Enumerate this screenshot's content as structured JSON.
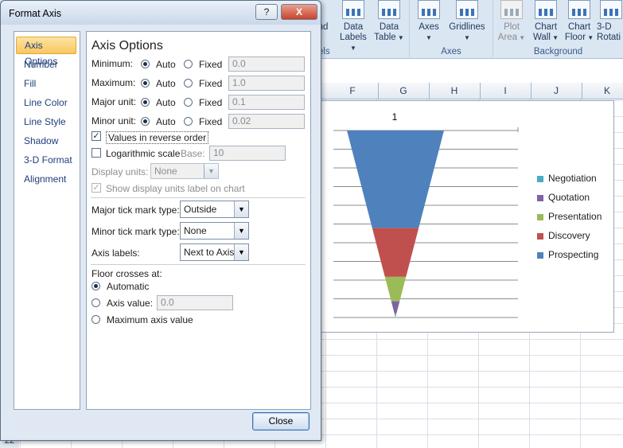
{
  "ribbon": {
    "buttons": [
      {
        "label": "nd",
        "disabled": false
      },
      {
        "label": "Data",
        "label2": "Labels",
        "dropdown": true,
        "disabled": false
      },
      {
        "label": "Data",
        "label2": "Table",
        "dropdown": true,
        "disabled": false
      },
      {
        "label": "Axes",
        "dropdown": true,
        "disabled": false
      },
      {
        "label": "Gridlines",
        "dropdown": true,
        "disabled": false
      },
      {
        "label": "Plot",
        "label2": "Area",
        "dropdown": true,
        "disabled": true
      },
      {
        "label": "Chart",
        "label2": "Wall",
        "dropdown": true,
        "disabled": false
      },
      {
        "label": "Chart",
        "label2": "Floor",
        "dropdown": true,
        "disabled": false
      },
      {
        "label": "3-D",
        "label2": "Rotati",
        "disabled": false
      }
    ],
    "groups": {
      "labels_fragment": "els",
      "axes": "Axes",
      "background": "Background"
    }
  },
  "sheet": {
    "columns": [
      "F",
      "G",
      "H",
      "I",
      "J",
      "K"
    ],
    "row_fragment": "22"
  },
  "chart_data": {
    "type": "bar",
    "title": "1",
    "series": [
      {
        "name": "Negotiation",
        "values": [
          0.5
        ],
        "color": "#4bacc6"
      },
      {
        "name": "Quotation",
        "values": [
          1.5
        ],
        "color": "#8064a2"
      },
      {
        "name": "Presentation",
        "values": [
          3
        ],
        "color": "#9bbb59"
      },
      {
        "name": "Discovery",
        "values": [
          6
        ],
        "color": "#c0504d"
      },
      {
        "name": "Prospecting",
        "values": [
          12
        ],
        "color": "#4f81bd"
      }
    ],
    "legend_position": "right",
    "horizontal_gridlines": true
  },
  "dialog": {
    "title": "Format Axis",
    "help_label": "?",
    "close_icon": "X",
    "nav": [
      "Axis Options",
      "Number",
      "Fill",
      "Line Color",
      "Line Style",
      "Shadow",
      "3-D Format",
      "Alignment"
    ],
    "active_nav": 0,
    "section_title": "Axis Options",
    "minimum": {
      "label": "Minimum:",
      "auto": "Auto",
      "fixed": "Fixed",
      "value": "0.0"
    },
    "maximum": {
      "label": "Maximum:",
      "auto": "Auto",
      "fixed": "Fixed",
      "value": "1.0"
    },
    "major_unit": {
      "label": "Major unit:",
      "auto": "Auto",
      "fixed": "Fixed",
      "value": "0.1"
    },
    "minor_unit": {
      "label": "Minor unit:",
      "auto": "Auto",
      "fixed": "Fixed",
      "value": "0.02"
    },
    "reverse_order": {
      "label": "Values in reverse order",
      "checked": true
    },
    "log_scale": {
      "label": "Logarithmic scale",
      "checked": false,
      "base_label": "Base:",
      "base_value": "10"
    },
    "display_units": {
      "label": "Display units:",
      "value": "None"
    },
    "show_units_label": {
      "label": "Show display units label on chart",
      "checked": true
    },
    "major_tick": {
      "label": "Major tick mark type:",
      "value": "Outside"
    },
    "minor_tick": {
      "label": "Minor tick mark type:",
      "value": "None"
    },
    "axis_labels": {
      "label": "Axis labels:",
      "value": "Next to Axis"
    },
    "floor_crosses": {
      "label": "Floor crosses at:",
      "automatic": "Automatic",
      "axis_value": "Axis value:",
      "axis_value_field": "0.0",
      "maximum": "Maximum axis value"
    },
    "close_button": "Close"
  }
}
